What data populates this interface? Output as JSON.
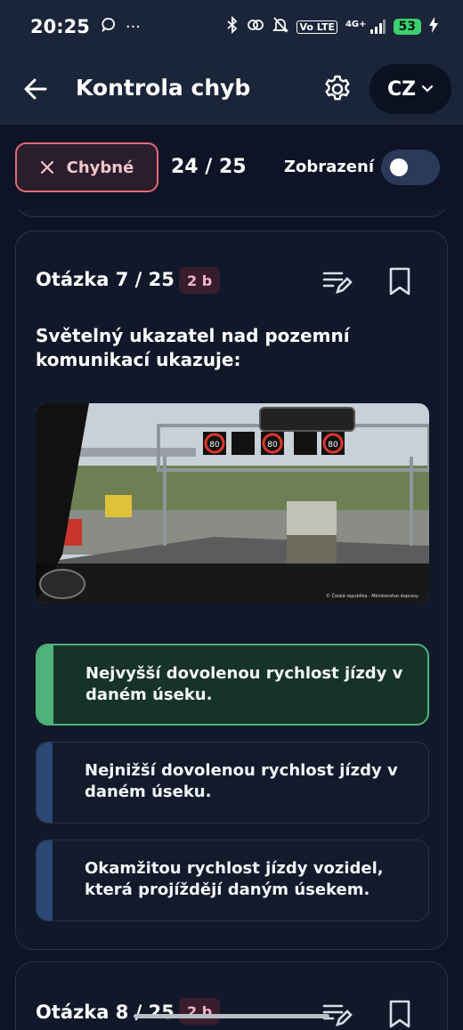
{
  "status_bar": {
    "time": "20:25",
    "battery": "53",
    "network": "4G+",
    "volte": "Vo LTE",
    "dots": "···"
  },
  "app_bar": {
    "title": "Kontrola chyb",
    "language": "CZ"
  },
  "filter_bar": {
    "chip_label": "Chybné",
    "counter": "24 / 25",
    "toggle_label": "Zobrazení",
    "toggle_on": false
  },
  "question_card": {
    "header": "Otázka 7 / 25",
    "points": "2 b",
    "question": "Světelný ukazatel nad pozemní komunikací ukazuje:",
    "image_caption": "© Česká republika - Ministerstvo dopravy",
    "sign_value": "80",
    "answers": [
      {
        "text": "Nejvyšší dovolenou rychlost jízdy v daném úseku.",
        "correct": true
      },
      {
        "text": "Nejnižší dovolenou rychlost jízdy v daném úseku.",
        "correct": false
      },
      {
        "text": "Okamžitou rychlost jízdy vozidel, která projíždějí daným úsekem.",
        "correct": false
      }
    ]
  },
  "next_card": {
    "header": "Otázka 8 / 25",
    "points": "2 b"
  },
  "colors": {
    "background": "#0e1425",
    "appbar": "#1b2539",
    "correct": "#4fb27a",
    "accent_red": "#e26a75",
    "answer_bar": "#2b4774"
  },
  "icons": [
    "back-arrow-icon",
    "gear-icon",
    "chevron-down-icon",
    "close-icon",
    "note-edit-icon",
    "bookmark-icon"
  ]
}
